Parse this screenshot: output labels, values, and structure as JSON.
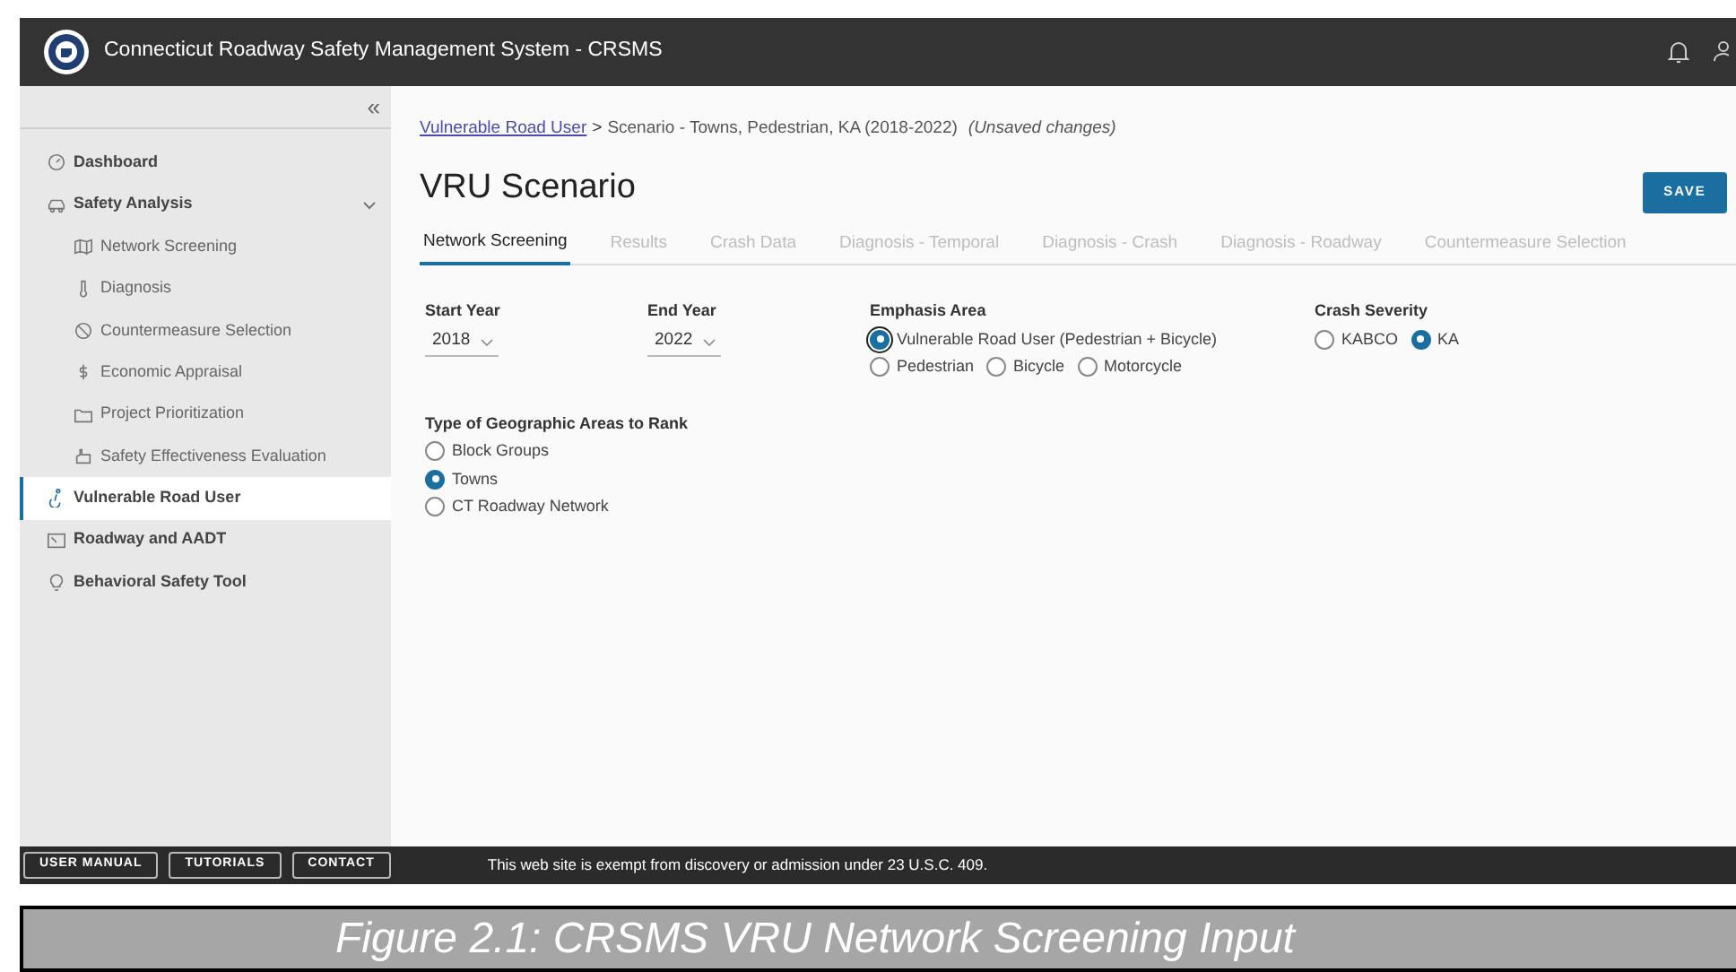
{
  "header": {
    "title": "Connecticut Roadway Safety Management System - CRSMS"
  },
  "sidebar": {
    "collapse": "«",
    "items": [
      {
        "label": "Dashboard",
        "kind": "section",
        "selected": false
      },
      {
        "label": "Safety Analysis",
        "kind": "section",
        "selected": false,
        "expanded": true,
        "children": [
          {
            "label": "Network Screening",
            "kind": "sub",
            "selected": false
          },
          {
            "label": "Diagnosis",
            "kind": "sub",
            "selected": false
          },
          {
            "label": "Countermeasure Selection",
            "kind": "sub",
            "selected": false
          },
          {
            "label": "Economic Appraisal",
            "kind": "sub",
            "selected": false
          },
          {
            "label": "Project Prioritization",
            "kind": "sub",
            "selected": false
          },
          {
            "label": "Safety Effectiveness Evaluation",
            "kind": "sub",
            "selected": false
          }
        ]
      },
      {
        "label": "Vulnerable Road User",
        "kind": "section",
        "selected": true
      },
      {
        "label": "Roadway and AADT",
        "kind": "section",
        "selected": false
      },
      {
        "label": "Behavioral Safety Tool",
        "kind": "section",
        "selected": false
      }
    ]
  },
  "breadcrumb": {
    "link": "Vulnerable Road User",
    "separator": ">",
    "current": "Scenario - Towns, Pedestrian, KA (2018-2022)",
    "note": "(Unsaved changes)"
  },
  "page_title": "VRU Scenario",
  "save_button": "SAVE",
  "tabs": [
    {
      "label": "Network Screening",
      "selected": true,
      "disabled": false
    },
    {
      "label": "Results",
      "selected": false,
      "disabled": true
    },
    {
      "label": "Crash Data",
      "selected": false,
      "disabled": true
    },
    {
      "label": "Diagnosis - Temporal",
      "selected": false,
      "disabled": true
    },
    {
      "label": "Diagnosis - Crash",
      "selected": false,
      "disabled": true
    },
    {
      "label": "Diagnosis - Roadway",
      "selected": false,
      "disabled": true
    },
    {
      "label": "Countermeasure Selection",
      "selected": false,
      "disabled": true
    }
  ],
  "start_year": {
    "label": "Start Year",
    "value": "2018"
  },
  "end_year": {
    "label": "End Year",
    "value": "2022"
  },
  "emphasis_area": {
    "label": "Emphasis Area",
    "options": [
      {
        "label": "Vulnerable Road User (Pedestrian + Bicycle)",
        "selected": true,
        "focused": true
      },
      {
        "label": "Pedestrian",
        "selected": false,
        "focused": false
      },
      {
        "label": "Bicycle",
        "selected": false,
        "focused": false
      },
      {
        "label": "Motorcycle",
        "selected": false,
        "focused": false
      }
    ]
  },
  "crash_severity": {
    "label": "Crash Severity",
    "options": [
      {
        "label": "KABCO",
        "selected": false
      },
      {
        "label": "KA",
        "selected": true
      }
    ]
  },
  "geographic_areas": {
    "label": "Type of Geographic Areas to Rank",
    "options": [
      {
        "label": "Block Groups",
        "selected": false
      },
      {
        "label": "Towns",
        "selected": true
      },
      {
        "label": "CT Roadway Network",
        "selected": false
      }
    ]
  },
  "footer": {
    "buttons": [
      "USER MANUAL",
      "TUTORIALS",
      "CONTACT"
    ],
    "notice": "This web site is exempt from discovery or admission under 23 U.S.C. 409."
  },
  "caption": "Figure 2.1: CRSMS VRU Network Screening Input"
}
